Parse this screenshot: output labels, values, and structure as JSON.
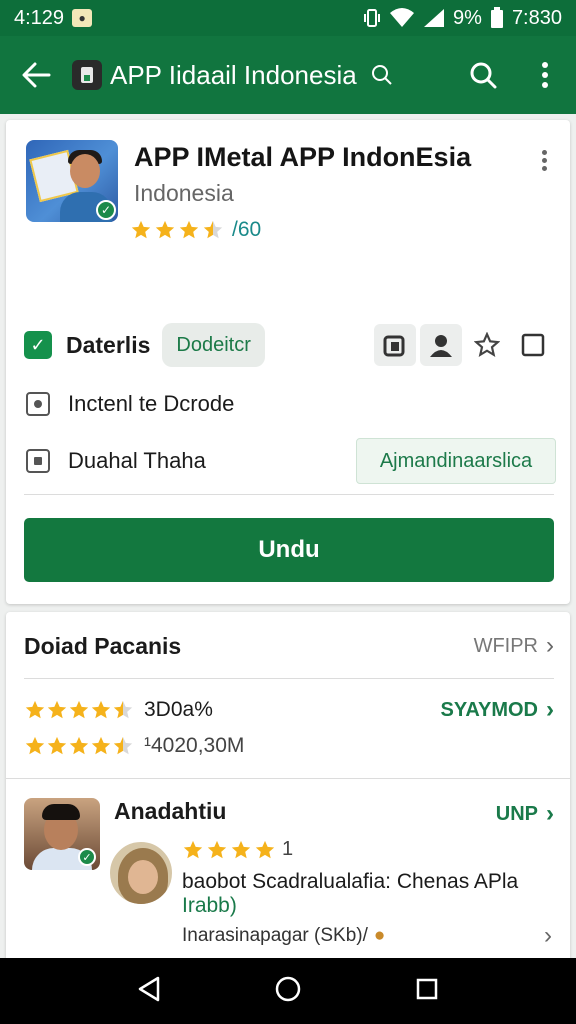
{
  "status_bar": {
    "time_left": "4:129",
    "battery_pct": "9%",
    "clock": "7:830"
  },
  "app_bar": {
    "title": "APP Iidaail Indonesia"
  },
  "app": {
    "name": "APP IMetal APP IndonEsia",
    "developer": "Indonesia",
    "rating_count": "/60",
    "rating_stars": 3.5,
    "badge_label": "Daterlis",
    "chip_label": "Dodeitcr",
    "feature1": "Inctenl te Dcrode",
    "feature2": "Duahal Thaha",
    "secondary_action": "Ajmandinaarslica",
    "install_label": "Undu"
  },
  "details": {
    "section_title": "Doiad Pacanis",
    "section_link": "WFIPR",
    "stat1_value": "3D0a%",
    "stat1_link": "SYAYMOD",
    "stat2_value": "¹4020,30M",
    "reviewer_name": "Anadahtiu",
    "reviewer_link": "UNP",
    "review_rating_num": "1",
    "review_text": "baobot Scadralualafia: Chenas APla",
    "review_sub": "Irabb)",
    "review_footer": "Inarasinapagar (SKb)/"
  },
  "colors": {
    "primary": "#11753f",
    "status": "#0d6e3a",
    "star": "#f5b21b"
  },
  "icons": [
    "arrow-left-icon",
    "search-icon",
    "more-vert-icon",
    "check-icon",
    "star-icon",
    "chevron-right-icon",
    "back-triangle-icon",
    "home-circle-icon",
    "recents-square-icon"
  ]
}
